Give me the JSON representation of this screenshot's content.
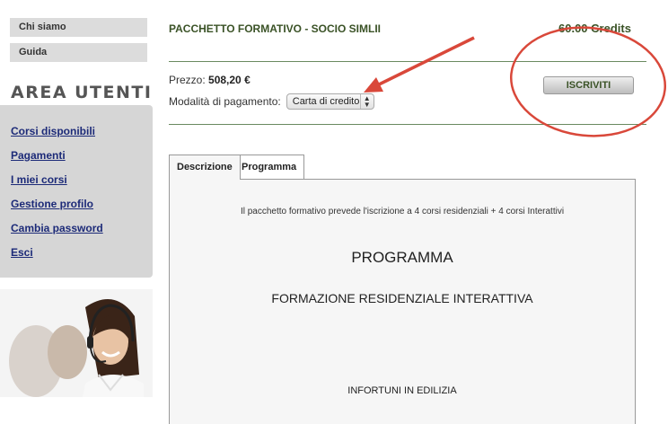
{
  "sidebar": {
    "top_links": [
      "Chi siamo",
      "Guida"
    ],
    "area_title": "AREA UTENTI",
    "area_links": [
      "Corsi disponibili",
      "Pagamenti",
      "I miei corsi",
      "Gestione profilo",
      "Cambia password",
      "Esci"
    ]
  },
  "package": {
    "title": "PACCHETTO FORMATIVO - SOCIO SIMLII",
    "credits": "60.00 Credits",
    "price_label": "Prezzo:",
    "price_value": "508,20 €",
    "payment_label": "Modalità di pagamento:",
    "payment_selected": "Carta di credito",
    "subscribe_button": "ISCRIVITI"
  },
  "tabs": [
    "Descrizione",
    "Programma"
  ],
  "content": {
    "description": "Il pacchetto formativo prevede l'iscrizione a 4 corsi residenziali  + 4 corsi Interattivi",
    "heading": "PROGRAMMA",
    "subheading": "FORMAZIONE RESIDENZIALE INTERATTIVA",
    "item": "INFORTUNI IN EDILIZIA"
  },
  "colors": {
    "accent_green": "#3a5226",
    "link_blue": "#1c2a78",
    "annotation_red": "#d9483a"
  }
}
